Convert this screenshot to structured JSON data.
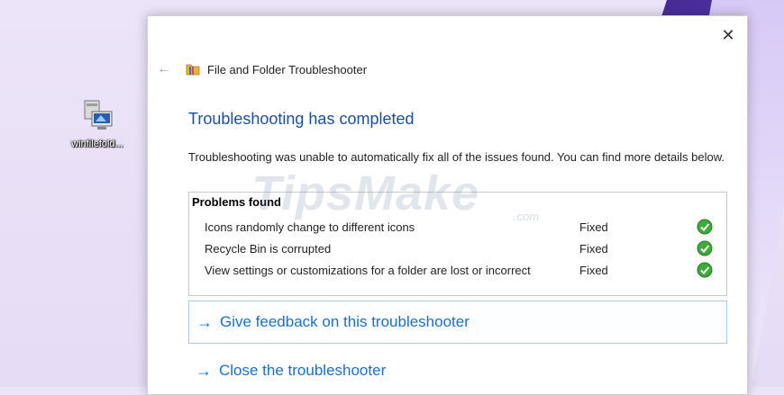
{
  "desktop": {
    "icon_label": "winfilefold..."
  },
  "dialog": {
    "close_glyph": "✕",
    "back_glyph": "←",
    "title": "File and Folder Troubleshooter",
    "heading": "Troubleshooting has completed",
    "description": "Troubleshooting was unable to automatically fix all of the issues found. You can find more details below.",
    "problems": {
      "header": "Problems found",
      "rows": [
        {
          "label": "Icons randomly change to different icons",
          "status": "Fixed",
          "icon": "check-icon"
        },
        {
          "label": "Recycle Bin is corrupted",
          "status": "Fixed",
          "icon": "check-icon"
        },
        {
          "label": "View settings or customizations for a folder are lost or incorrect",
          "status": "Fixed",
          "icon": "check-icon"
        }
      ]
    },
    "links": {
      "arrow_glyph": "→",
      "feedback": "Give feedback on this troubleshooter",
      "close": "Close the troubleshooter"
    }
  },
  "watermark": {
    "main": "TipsMake",
    "suffix": ".com"
  },
  "colors": {
    "heading": "#1c4e9a",
    "link": "#1a6fc9",
    "check_green": "#3fa93a"
  }
}
